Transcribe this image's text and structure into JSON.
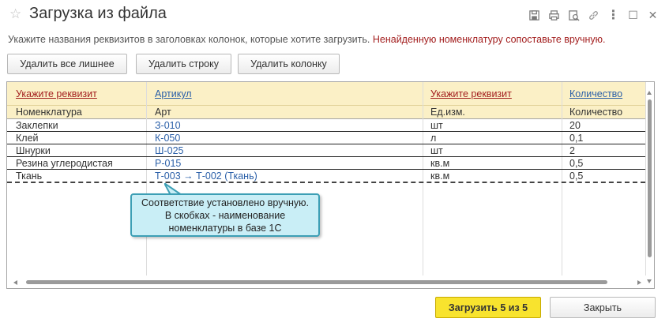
{
  "window": {
    "title": "Загрузка из файла",
    "toolbar_icons": [
      "star-icon",
      "save-icon",
      "print-icon",
      "preview-icon",
      "link-icon",
      "more-icon",
      "maximize-icon",
      "close-icon"
    ],
    "more_glyph": "⋮",
    "maximize_glyph": "☐",
    "close_glyph": "✕",
    "star_glyph": "☆"
  },
  "hint": {
    "text": "Укажите названия реквизитов в заголовках колонок, которые хотите загрузить.",
    "warning": "Ненайденную номенклатуру сопоставьте вручную."
  },
  "actions": {
    "delete_extra": "Удалить все лишнее",
    "delete_row": "Удалить строку",
    "delete_column": "Удалить колонку"
  },
  "table": {
    "header_links": [
      "Укажите реквизит",
      "Артикул",
      "Укажите реквизит",
      "Количество"
    ],
    "header_subtitles": [
      "Номенклатура",
      "Арт",
      "Ед.изм.",
      "Количество"
    ],
    "rows": [
      [
        "Заклепки",
        "З-010",
        "шт",
        "20"
      ],
      [
        "Клей",
        "К-050",
        "л",
        "0,1"
      ],
      [
        "Шнурки",
        "Ш-025",
        "шт",
        "2"
      ],
      [
        "Резина углеродистая",
        "Р-015",
        "кв.м",
        "0,5"
      ],
      [
        "Ткань",
        "Т-003 → Т-002 (Ткань)",
        "кв.м",
        "0,5"
      ]
    ]
  },
  "callout": {
    "line1": "Соответствие установлено вручную.",
    "line2": "В скобках - наименование",
    "line3": "номенклатуры в базе 1С"
  },
  "footer": {
    "load_button": "Загрузить 5 из 5",
    "close_button": "Закрыть"
  },
  "colors": {
    "header_bg": "#fbf0c6",
    "warning_red": "#a31f1f",
    "link_blue": "#2a5fa8",
    "primary_button": "#f8e32e",
    "callout_bg": "#c9eef6",
    "callout_border": "#3d9fb5"
  }
}
